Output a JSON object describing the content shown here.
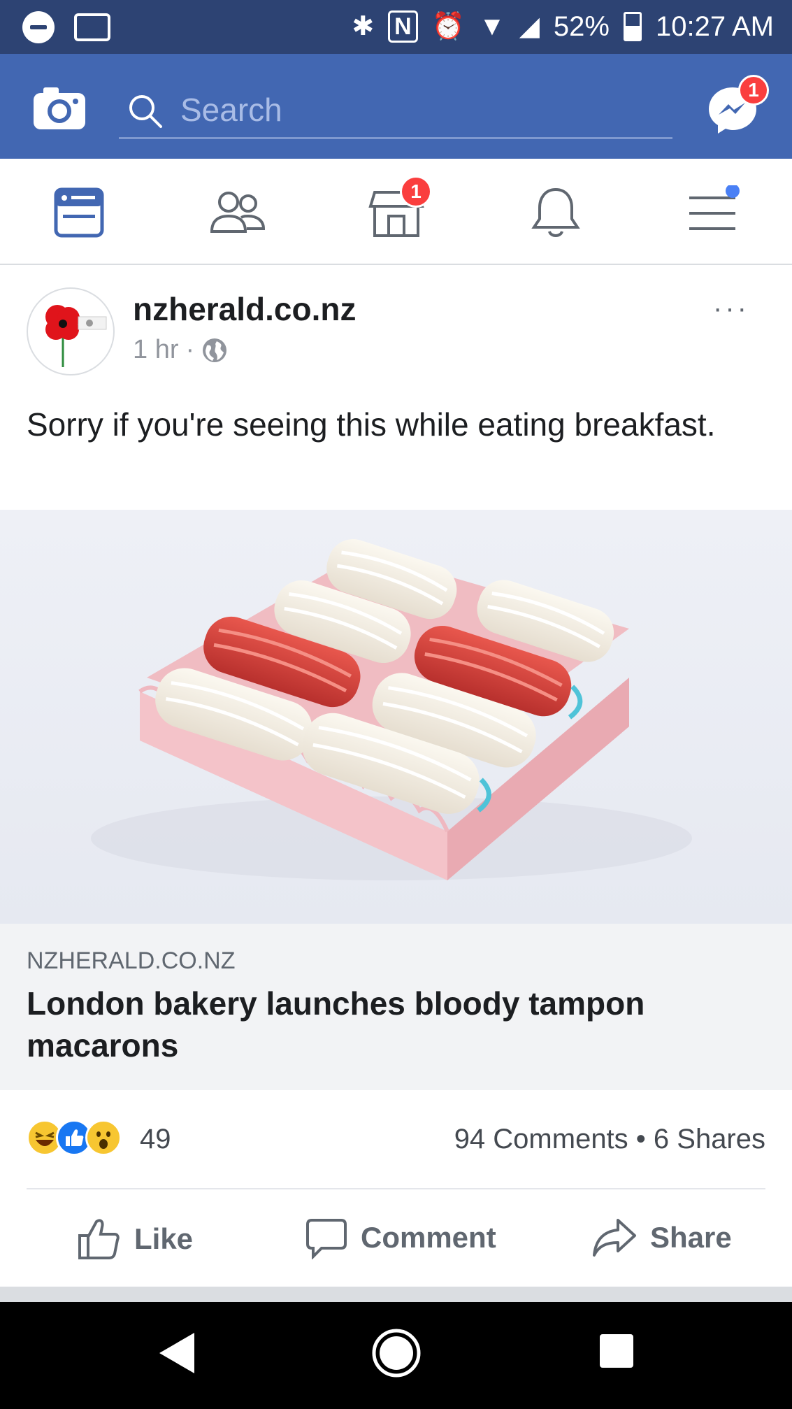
{
  "status_bar": {
    "battery": "52%",
    "time": "10:27 AM"
  },
  "header": {
    "search_placeholder": "Search",
    "messenger_badge": "1"
  },
  "nav": {
    "marketplace_badge": "1"
  },
  "post": {
    "page_name": "nzherald.co.nz",
    "time": "1 hr",
    "separator": "·",
    "more": "···",
    "text": "Sorry if you're seeing this while eating breakfast.",
    "link": {
      "domain": "NZHERALD.CO.NZ",
      "title": "London bakery launches bloody tampon macarons"
    },
    "reaction_count": "49",
    "comments_shares": "94 Comments • 6 Shares",
    "actions": {
      "like": "Like",
      "comment": "Comment",
      "share": "Share"
    }
  },
  "colors": {
    "facebook_blue": "#4267b2",
    "status_bar": "#2d4373",
    "badge_red": "#fa3e3e",
    "active_icon": "#4267b2"
  },
  "icons": [
    "camera-icon",
    "search-icon",
    "messenger-icon",
    "news-feed-icon",
    "friends-icon",
    "marketplace-icon",
    "bell-icon",
    "menu-icon",
    "globe-icon",
    "like-icon",
    "comment-icon",
    "share-icon",
    "back-icon",
    "home-icon",
    "recents-icon"
  ]
}
